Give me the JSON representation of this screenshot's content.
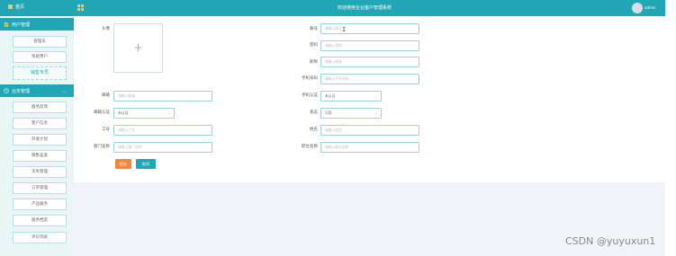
{
  "header": {
    "home_label": "首页",
    "title": "欢迎使用企业客户管理系统",
    "user": "admin"
  },
  "sidebar": {
    "sections": [
      {
        "label": "用户管理",
        "items": [
          "管理员",
          "系统用户",
          "销售专员"
        ],
        "active_item": "销售专员"
      },
      {
        "label": "业务管理",
        "items": [
          "服务反馈",
          "客户信息",
          "开发计划",
          "销售差旅",
          "流失管理",
          "订单管理",
          "产品服务",
          "服务档案",
          "评论列表"
        ]
      }
    ]
  },
  "form": {
    "avatar_label": "头像",
    "upload_plus": "+",
    "account": {
      "label": "账号",
      "placeholder": "请输入账号"
    },
    "password": {
      "label": "密码",
      "placeholder": "请输入密码"
    },
    "nickname": {
      "label": "昵称",
      "placeholder": "请输入昵称"
    },
    "phone": {
      "label": "手机号码",
      "placeholder": "请输入手机号码"
    },
    "email": {
      "label": "邮箱",
      "placeholder": "请输入邮箱"
    },
    "phone_verify": {
      "label": "手机认证",
      "value": "未认证"
    },
    "email_verify": {
      "label": "邮箱认证",
      "value": "未认证"
    },
    "status": {
      "label": "状态",
      "value": "可用"
    },
    "employee_no": {
      "label": "工号",
      "placeholder": "请输入工号"
    },
    "name": {
      "label": "姓名",
      "placeholder": "请输入姓名"
    },
    "department": {
      "label": "部门名称",
      "placeholder": "请输入部门名称"
    },
    "position": {
      "label": "职位名称",
      "placeholder": "请输入职位名称"
    },
    "submit_label": "提交",
    "cancel_label": "取消"
  },
  "watermark": "CSDN @yuyuxun1",
  "colors": {
    "accent": "#21a6b5",
    "submit": "#f0883b",
    "cancel": "#21a6b5",
    "sidebar_bg": "#eaf6f6"
  }
}
